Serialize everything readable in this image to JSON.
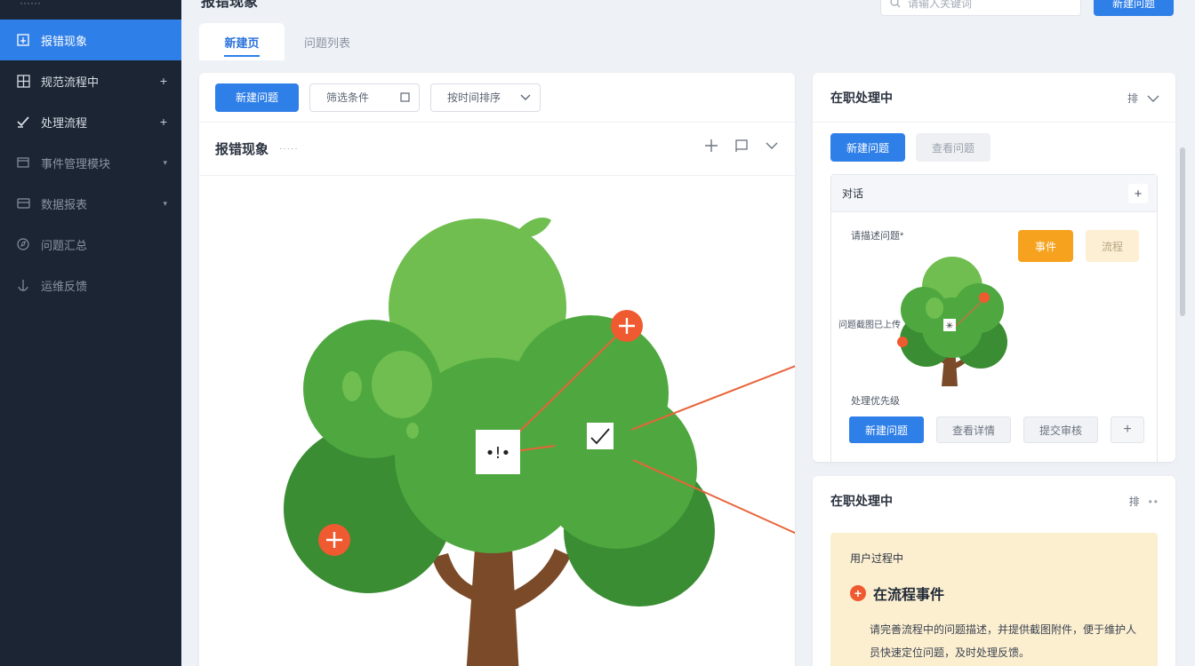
{
  "sidebar": {
    "top_label": "······",
    "items": [
      {
        "label": "报错现象",
        "icon": "report-icon",
        "suffix": "",
        "active": true
      },
      {
        "label": "规范流程中",
        "icon": "grid-icon",
        "suffix": "+",
        "active": false
      },
      {
        "label": "处理流程",
        "icon": "check-icon",
        "suffix": "+",
        "active": false
      },
      {
        "label": "事件管理模块",
        "icon": "box-icon",
        "suffix": "▾",
        "active": false
      },
      {
        "label": "数据报表",
        "icon": "card-icon",
        "suffix": "▾",
        "active": false
      },
      {
        "label": "问题汇总",
        "icon": "compass-icon",
        "suffix": "",
        "active": false
      },
      {
        "label": "运维反馈",
        "icon": "anchor-icon",
        "suffix": "",
        "active": false
      }
    ]
  },
  "header": {
    "title": "报错现象",
    "search_placeholder": "请输入关键词",
    "top_button": "新建问题"
  },
  "tabs": [
    {
      "label": "新建页",
      "active": true
    },
    {
      "label": "问题列表",
      "active": false
    }
  ],
  "toolbar": {
    "primary": "新建问题",
    "filter": "筛选条件",
    "dropdown": "按时间排序"
  },
  "main": {
    "title": "报错现象",
    "subtitle": "·····"
  },
  "right_panel_1": {
    "title": "在职处理中",
    "action_label": "排",
    "tab_active": "新建问题",
    "tab_inactive": "查看问题",
    "card_title": "对话",
    "label_top": "请描述问题*",
    "label_mid": "问题截图已上传",
    "label_bottom": "处理优先级",
    "tag_orange": "事件",
    "tag_cream": "流程",
    "buttons": [
      "新建问题",
      "查看详情",
      "提交审核"
    ],
    "add_button": "+"
  },
  "right_panel_2": {
    "title": "在职处理中",
    "action_label": "排",
    "note_caption": "用户过程中",
    "note_heading": "在流程事件",
    "note_body": "请完善流程中的问题描述，并提供截图附件，便于维护人员快速定位问题，及时处理反馈。"
  },
  "colors": {
    "accent": "#2f7fe8",
    "sidebar_bg": "#1c2533",
    "tree_light": "#6fbe4f",
    "tree_mid": "#4ea83f",
    "tree_dark": "#3a8d33",
    "trunk": "#7b4a28",
    "marker": "#ef5a30",
    "orange": "#f6a21e"
  }
}
